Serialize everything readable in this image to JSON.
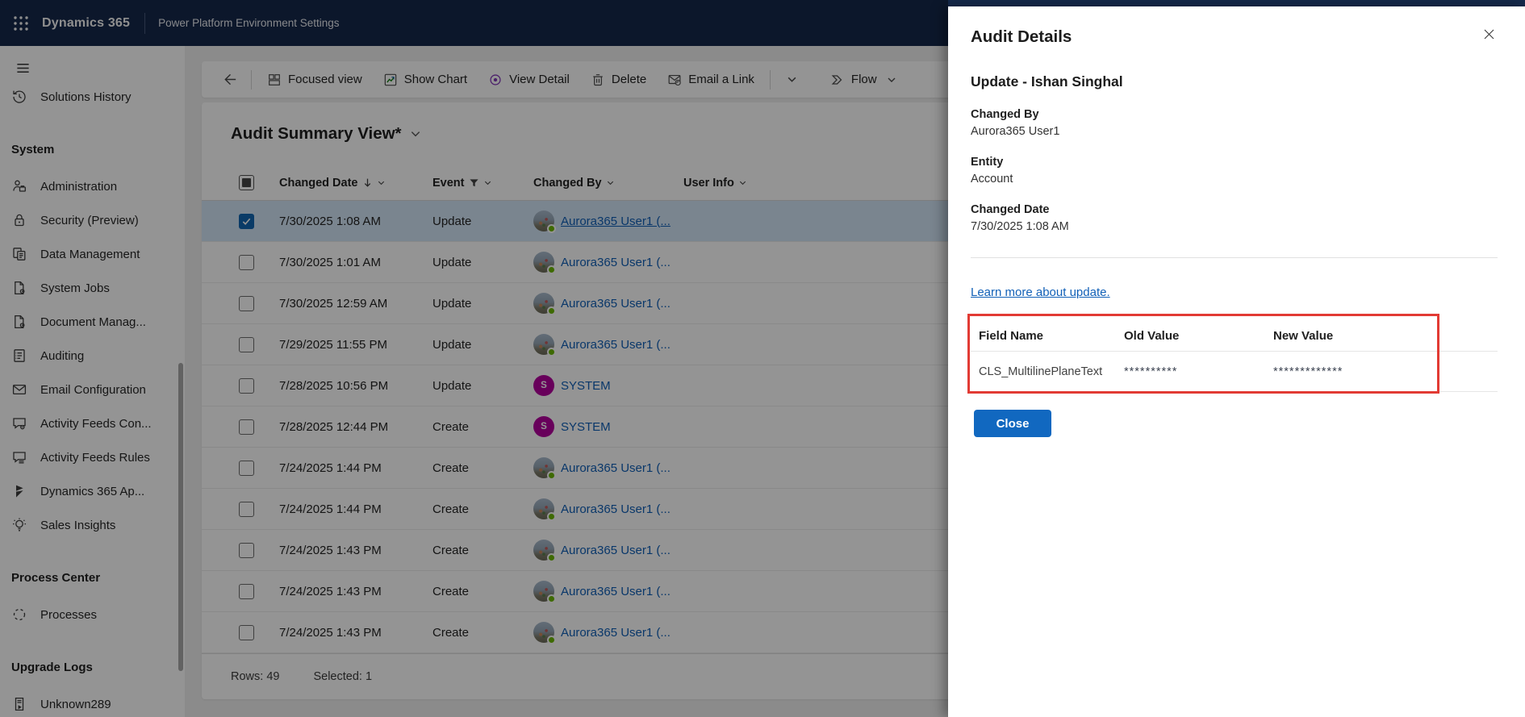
{
  "topbar": {
    "app": "Dynamics 365",
    "subtitle": "Power Platform Environment Settings"
  },
  "sidebar": {
    "items_top": [
      {
        "label": "Solutions History",
        "icon": "history"
      }
    ],
    "sections": [
      {
        "header": "System",
        "items": [
          {
            "label": "Administration",
            "icon": "admin"
          },
          {
            "label": "Security (Preview)",
            "icon": "lock"
          },
          {
            "label": "Data Management",
            "icon": "copy"
          },
          {
            "label": "System Jobs",
            "icon": "doc-gear"
          },
          {
            "label": "Document Manag...",
            "icon": "doc-gear"
          },
          {
            "label": "Auditing",
            "icon": "audit-list"
          },
          {
            "label": "Email Configuration",
            "icon": "mail"
          },
          {
            "label": "Activity Feeds Con...",
            "icon": "chat-gear"
          },
          {
            "label": "Activity Feeds Rules",
            "icon": "chat-list"
          },
          {
            "label": "Dynamics 365 Ap...",
            "icon": "d365"
          },
          {
            "label": "Sales Insights",
            "icon": "bulb"
          }
        ]
      },
      {
        "header": "Process Center",
        "items": [
          {
            "label": "Processes",
            "icon": "dashed-circle"
          }
        ]
      },
      {
        "header": "Upgrade Logs",
        "items": [
          {
            "label": "Unknown289",
            "icon": "doc-play"
          }
        ]
      }
    ]
  },
  "toolbar": {
    "buttons": [
      {
        "label": "Focused view",
        "icon": "grid"
      },
      {
        "label": "Show Chart",
        "icon": "chart"
      },
      {
        "label": "View Detail",
        "icon": "view"
      },
      {
        "label": "Delete",
        "icon": "trash"
      },
      {
        "label": "Email a Link",
        "icon": "mail-link"
      }
    ],
    "flow_label": "Flow"
  },
  "view": {
    "title": "Audit Summary View*"
  },
  "table": {
    "columns": [
      "Changed Date",
      "Event",
      "Changed By",
      "User Info"
    ],
    "rows": [
      {
        "date": "7/30/2025 1:08 AM",
        "event": "Update",
        "by": "Aurora365 User1 (...",
        "kind": "user",
        "selected": true
      },
      {
        "date": "7/30/2025 1:01 AM",
        "event": "Update",
        "by": "Aurora365 User1 (...",
        "kind": "user",
        "selected": false
      },
      {
        "date": "7/30/2025 12:59 AM",
        "event": "Update",
        "by": "Aurora365 User1 (...",
        "kind": "user",
        "selected": false
      },
      {
        "date": "7/29/2025 11:55 PM",
        "event": "Update",
        "by": "Aurora365 User1 (...",
        "kind": "user",
        "selected": false
      },
      {
        "date": "7/28/2025 10:56 PM",
        "event": "Update",
        "by": "SYSTEM",
        "kind": "system",
        "selected": false
      },
      {
        "date": "7/28/2025 12:44 PM",
        "event": "Create",
        "by": "SYSTEM",
        "kind": "system",
        "selected": false
      },
      {
        "date": "7/24/2025 1:44 PM",
        "event": "Create",
        "by": "Aurora365 User1 (...",
        "kind": "user",
        "selected": false
      },
      {
        "date": "7/24/2025 1:44 PM",
        "event": "Create",
        "by": "Aurora365 User1 (...",
        "kind": "user",
        "selected": false
      },
      {
        "date": "7/24/2025 1:43 PM",
        "event": "Create",
        "by": "Aurora365 User1 (...",
        "kind": "user",
        "selected": false
      },
      {
        "date": "7/24/2025 1:43 PM",
        "event": "Create",
        "by": "Aurora365 User1 (...",
        "kind": "user",
        "selected": false
      },
      {
        "date": "7/24/2025 1:43 PM",
        "event": "Create",
        "by": "Aurora365 User1 (...",
        "kind": "user",
        "selected": false
      }
    ]
  },
  "footer": {
    "rows_label": "Rows: 49",
    "selected_label": "Selected: 1"
  },
  "panel": {
    "title": "Audit Details",
    "subtitle": "Update - Ishan Singhal",
    "fields": [
      {
        "label": "Changed By",
        "value": "Aurora365 User1"
      },
      {
        "label": "Entity",
        "value": "Account"
      },
      {
        "label": "Changed Date",
        "value": "7/30/2025 1:08 AM"
      }
    ],
    "link": "Learn more about update.",
    "change_table": {
      "columns": [
        "Field Name",
        "Old Value",
        "New Value"
      ],
      "rows": [
        {
          "field": "CLS_MultilinePlaneText",
          "old": "**********",
          "new": "*************"
        }
      ]
    },
    "close_button": "Close"
  },
  "colors": {
    "topbar": "#15294b",
    "accent": "#1267b1",
    "link": "#1160b7",
    "selected_row": "#d3e5f6",
    "system_avatar": "#b4009e",
    "presence": "#6bb700",
    "annotation_red": "#e23b34",
    "primary_button": "#1168c0"
  }
}
